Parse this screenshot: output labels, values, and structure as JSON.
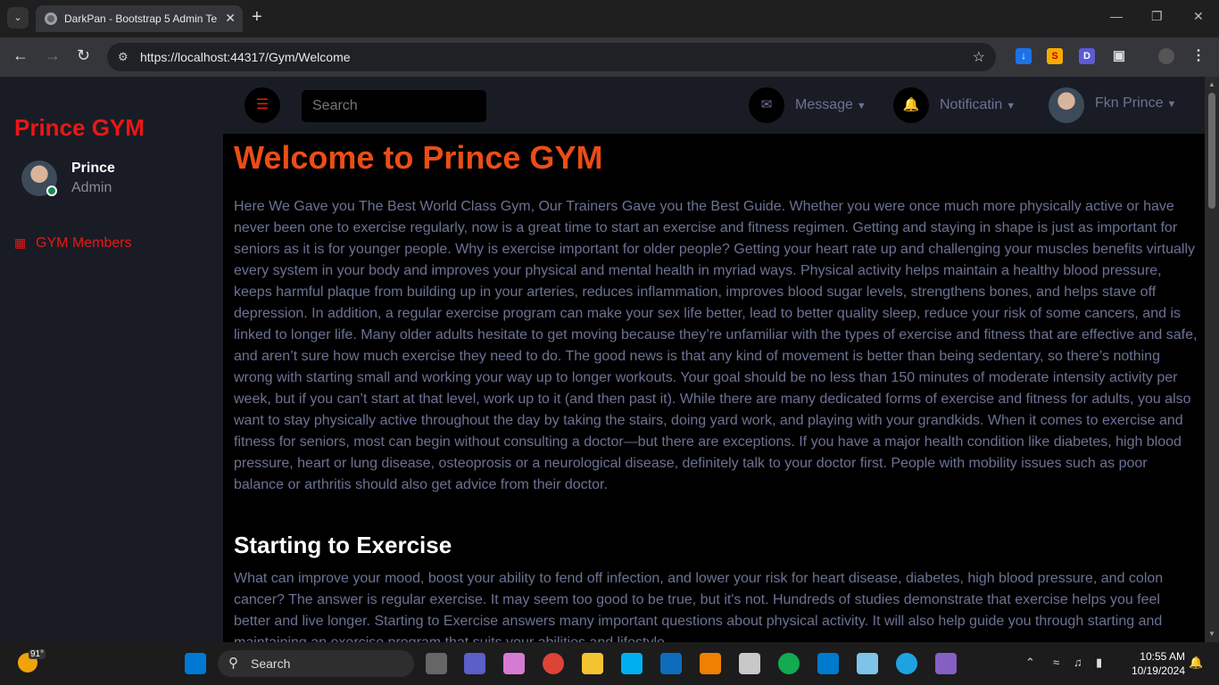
{
  "browser": {
    "tab_title": "DarkPan - Bootstrap 5 Admin Te",
    "url": "https://localhost:44317/Gym/Welcome"
  },
  "sidebar": {
    "brand": "Prince GYM",
    "user_name": "Prince",
    "user_role": "Admin",
    "items": [
      {
        "label": "GYM Members",
        "icon": "table-icon"
      }
    ]
  },
  "topnav": {
    "search_placeholder": "Search",
    "message_label": "Message",
    "notification_label": "Notificatin",
    "profile_name": "Fkn Prince"
  },
  "content": {
    "heading": "Welcome to Prince GYM",
    "paragraph1": "Here We Gave you The Best World Class Gym, Our Trainers Gave you the Best Guide. Whether you were once much more physically active or have never been one to exercise regularly, now is a great time to start an exercise and fitness regimen. Getting and staying in shape is just as important for seniors as it is for younger people. Why is exercise important for older people? Getting your heart rate up and challenging your muscles benefits virtually every system in your body and improves your physical and mental health in myriad ways. Physical activity helps maintain a healthy blood pressure, keeps harmful plaque from building up in your arteries, reduces inflammation, improves blood sugar levels, strengthens bones, and helps stave off depression. In addition, a regular exercise program can make your sex life better, lead to better quality sleep, reduce your risk of some cancers, and is linked to longer life. Many older adults hesitate to get moving because they’re unfamiliar with the types of exercise and fitness that are effective and safe, and aren’t sure how much exercise they need to do. The good news is that any kind of movement is better than being sedentary, so there’s nothing wrong with starting small and working your way up to longer workouts. Your goal should be no less than 150 minutes of moderate intensity activity per week, but if you can’t start at that level, work up to it (and then past it). While there are many dedicated forms of exercise and fitness for adults, you also want to stay physically active throughout the day by taking the stairs, doing yard work, and playing with your grandkids. When it comes to exercise and fitness for seniors, most can begin without consulting a doctor—but there are exceptions. If you have a major health condition like diabetes, high blood pressure, heart or lung disease, osteoprosis or a neurological disease, definitely talk to your doctor first. People with mobility issues such as poor balance or arthritis should also get advice from their doctor.",
    "subheading": "Starting to Exercise",
    "paragraph2": "What can improve your mood, boost your ability to fend off infection, and lower your risk for heart disease, diabetes, high blood pressure, and colon cancer? The answer is regular exercise. It may seem too good to be true, but it's not. Hundreds of studies demonstrate that exercise helps you feel better and live longer. Starting to Exercise answers many important questions about physical activity. It will also help guide you through starting and maintaining an exercise program that suits your abilities and lifestyle."
  },
  "taskbar": {
    "weather_temp": "91°",
    "search_label": "Search",
    "time": "10:55 AM",
    "date": "10/19/2024"
  },
  "colors": {
    "accent": "#eb1616",
    "heading": "#eb4d16",
    "panel": "#191c24",
    "muted_text": "#6c7293"
  }
}
